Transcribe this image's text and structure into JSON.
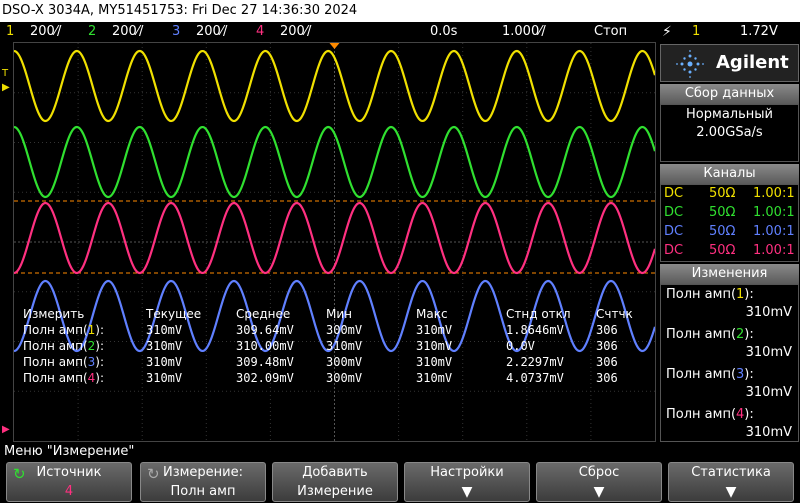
{
  "titlebar": {
    "text": "DSO-X 3034A, MY51451753: Fri Dec 27 14:36:30 2024"
  },
  "channels_top": [
    {
      "num": "1",
      "scale": "200⁄/",
      "color": "#f0e000"
    },
    {
      "num": "2",
      "scale": "200⁄/",
      "color": "#30e030"
    },
    {
      "num": "3",
      "scale": "200⁄/",
      "color": "#6080ff"
    },
    {
      "num": "4",
      "scale": "200⁄/",
      "color": "#ff3080"
    }
  ],
  "timebase": {
    "delay": "0.0s",
    "scale": "1.000⁄/",
    "run_state": "Стоп"
  },
  "trigger": {
    "icon": "trigger-edge-icon",
    "channel": "1",
    "level": "1.72V"
  },
  "logo": {
    "text": "Agilent"
  },
  "acquisition": {
    "title": "Сбор данных",
    "mode": "Нормальный",
    "rate": "2.00GSa/s"
  },
  "channels_panel": {
    "title": "Каналы",
    "rows": [
      {
        "coupling": "DC",
        "imp": "50Ω",
        "probe": "1.00:1",
        "color": "#f0e000"
      },
      {
        "coupling": "DC",
        "imp": "50Ω",
        "probe": "1.00:1",
        "color": "#30e030"
      },
      {
        "coupling": "DC",
        "imp": "50Ω",
        "probe": "1.00:1",
        "color": "#6080ff"
      },
      {
        "coupling": "DC",
        "imp": "50Ω",
        "probe": "1.00:1",
        "color": "#ff3080"
      }
    ]
  },
  "changes_panel": {
    "title": "Изменения",
    "items": [
      {
        "label": "Полн амп(",
        "ch": "1",
        "close": "):",
        "value": "310mV",
        "color": "#f0e000"
      },
      {
        "label": "Полн амп(",
        "ch": "2",
        "close": "):",
        "value": "310mV",
        "color": "#30e030"
      },
      {
        "label": "Полн амп(",
        "ch": "3",
        "close": "):",
        "value": "310mV",
        "color": "#6080ff"
      },
      {
        "label": "Полн амп(",
        "ch": "4",
        "close": "):",
        "value": "310mV",
        "color": "#ff3080"
      }
    ]
  },
  "measurements": {
    "headers": [
      "Измерить",
      "Текущее",
      "Среднее",
      "Мин",
      "Макс",
      "Стнд откл",
      "Счтчк"
    ],
    "rows": [
      {
        "name": "Полн амп(",
        "ch": "1",
        "close": "):",
        "color": "#f0e000",
        "cur": "310mV",
        "avg": "309.64mV",
        "min": "300mV",
        "max": "310mV",
        "std": "1.8646mV",
        "cnt": "306"
      },
      {
        "name": "Полн амп(",
        "ch": "2",
        "close": "):",
        "color": "#30e030",
        "cur": "310mV",
        "avg": "310.00mV",
        "min": "310mV",
        "max": "310mV",
        "std": "0.0V",
        "cnt": "306"
      },
      {
        "name": "Полн амп(",
        "ch": "3",
        "close": "):",
        "color": "#6080ff",
        "cur": "310mV",
        "avg": "309.48mV",
        "min": "300mV",
        "max": "310mV",
        "std": "2.2297mV",
        "cnt": "306"
      },
      {
        "name": "Полн амп(",
        "ch": "4",
        "close": "):",
        "color": "#ff3080",
        "cur": "310mV",
        "avg": "302.09mV",
        "min": "300mV",
        "max": "310mV",
        "std": "4.0737mV",
        "cnt": "306"
      }
    ]
  },
  "menu": {
    "title": "Меню \"Измерение\""
  },
  "softkeys": [
    {
      "l1": "Источник",
      "l2": "4",
      "l2color": "#ff3080",
      "knob": true,
      "arrow": false
    },
    {
      "l1": "Измерение:",
      "l2": "Полн амп",
      "l2color": "#ffffff",
      "knob": true,
      "arrow": false
    },
    {
      "l1": "Добавить",
      "l2": "Измерение",
      "l2color": "#ffffff",
      "knob": false,
      "arrow": false
    },
    {
      "l1": "Настройки",
      "l2": "",
      "l2color": "#ffffff",
      "knob": false,
      "arrow": true
    },
    {
      "l1": "Сброс",
      "l2": "",
      "l2color": "#ffffff",
      "knob": false,
      "arrow": true
    },
    {
      "l1": "Статистика",
      "l2": "",
      "l2color": "#ffffff",
      "knob": false,
      "arrow": true
    }
  ],
  "waveforms": [
    {
      "channel": "1",
      "color": "#f0e000",
      "cycles": 10.2,
      "phase": 0.0
    },
    {
      "channel": "2",
      "color": "#30e030",
      "cycles": 10.2,
      "phase": 0.0
    },
    {
      "channel": "4",
      "color": "#ff3080",
      "cycles": 10.2,
      "phase": 0.5
    },
    {
      "channel": "3",
      "color": "#6080ff",
      "cycles": 10.2,
      "phase": 0.5
    }
  ]
}
